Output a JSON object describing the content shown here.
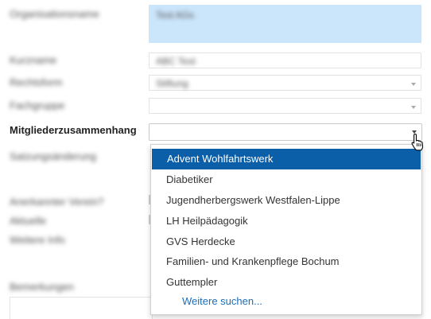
{
  "form": {
    "field_org_name": {
      "label": "Organisationsname",
      "value": "Test AGs"
    },
    "field_kuerzel": {
      "label": "Kurzname",
      "value": "ABC Test"
    },
    "field_status": {
      "label": "Rechtsform",
      "value": "Stiftung"
    },
    "field_fachgruppe": {
      "label": "Fachgruppe",
      "value": ""
    },
    "field_mitglieder": {
      "label": "Mitgliederzusammenhang",
      "value": ""
    },
    "field_satzung": {
      "label": "Satzungsänderung"
    },
    "field_anerkannt": {
      "label": "Anerkannter Verein?"
    },
    "field_aktuelle": {
      "label": "Aktuelle"
    },
    "field_weitere": {
      "label": "Weitere Info"
    },
    "field_bemerkungen": {
      "label": "Bemerkungen"
    }
  },
  "dropdown": {
    "options": [
      "Advent Wohlfahrtswerk",
      "Diabetiker",
      "Jugendherbergswerk Westfalen-Lippe",
      "LH Heilpädagogik",
      "GVS Herdecke",
      "Familien- und Krankenpflege Bochum",
      "Guttempler"
    ],
    "more_link": "Weitere suchen...",
    "selected_index": 0
  },
  "colors": {
    "selection": "#0b5ea8",
    "highlight_field": "#cbe5fb",
    "link": "#1f6db5"
  },
  "icons": {
    "cursor": "hand-pointer-icon",
    "dropdown_caret": "chevron-down-icon"
  }
}
